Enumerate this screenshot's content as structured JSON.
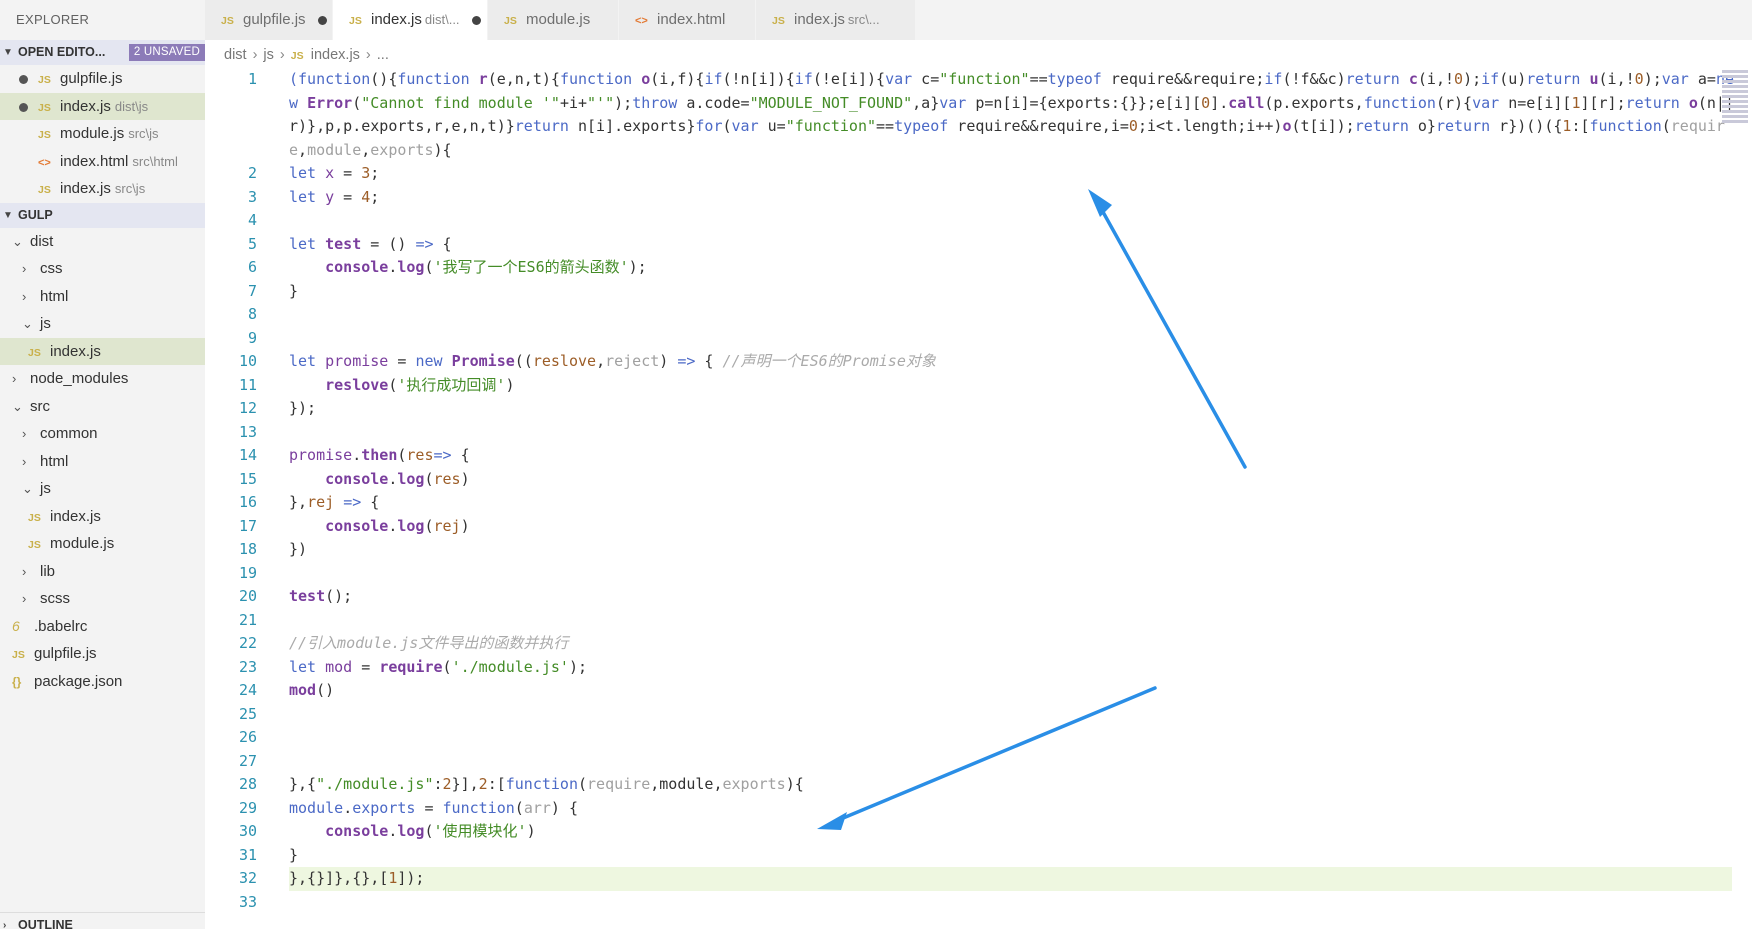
{
  "sidebar": {
    "title": "EXPLORER",
    "open_editors": {
      "label": "OPEN EDITO...",
      "badge": "2 UNSAVED",
      "items": [
        {
          "name": "gulpfile.js",
          "desc": "",
          "icon": "JS",
          "dirty": true,
          "selected": false
        },
        {
          "name": "index.js",
          "desc": "dist\\js",
          "icon": "JS",
          "dirty": true,
          "selected": true
        },
        {
          "name": "module.js",
          "desc": "src\\js",
          "icon": "JS",
          "dirty": false,
          "selected": false
        },
        {
          "name": "index.html",
          "desc": "src\\html",
          "icon": "<>",
          "dirty": false,
          "selected": false
        },
        {
          "name": "index.js",
          "desc": "src\\js",
          "icon": "JS",
          "dirty": false,
          "selected": false
        }
      ]
    },
    "workspace": {
      "label": "GULP",
      "tree": [
        {
          "name": "dist",
          "type": "folder",
          "open": true,
          "depth": 0
        },
        {
          "name": "css",
          "type": "folder",
          "open": false,
          "depth": 1
        },
        {
          "name": "html",
          "type": "folder",
          "open": false,
          "depth": 1
        },
        {
          "name": "js",
          "type": "folder",
          "open": true,
          "depth": 1
        },
        {
          "name": "index.js",
          "type": "js",
          "depth": 2,
          "selected": true
        },
        {
          "name": "node_modules",
          "type": "folder",
          "open": false,
          "depth": 0
        },
        {
          "name": "src",
          "type": "folder",
          "open": true,
          "depth": 0
        },
        {
          "name": "common",
          "type": "folder",
          "open": false,
          "depth": 1
        },
        {
          "name": "html",
          "type": "folder",
          "open": false,
          "depth": 1
        },
        {
          "name": "js",
          "type": "folder",
          "open": true,
          "depth": 1
        },
        {
          "name": "index.js",
          "type": "js",
          "depth": 2
        },
        {
          "name": "module.js",
          "type": "js",
          "depth": 2
        },
        {
          "name": "lib",
          "type": "folder",
          "open": false,
          "depth": 1
        },
        {
          "name": "scss",
          "type": "folder",
          "open": false,
          "depth": 1
        },
        {
          "name": ".babelrc",
          "type": "babel",
          "depth": 0
        },
        {
          "name": "gulpfile.js",
          "type": "js",
          "depth": 0
        },
        {
          "name": "package.json",
          "type": "json",
          "depth": 0
        }
      ]
    },
    "outline_label": "OUTLINE"
  },
  "tabs": [
    {
      "label": "gulpfile.js",
      "desc": "",
      "icon": "JS",
      "dirty": true,
      "active": false
    },
    {
      "label": "index.js",
      "desc": "dist\\...",
      "icon": "JS",
      "dirty": true,
      "active": true
    },
    {
      "label": "module.js",
      "desc": "",
      "icon": "JS",
      "dirty": false,
      "active": false
    },
    {
      "label": "index.html",
      "desc": "",
      "icon": "<>",
      "dirty": false,
      "active": false
    },
    {
      "label": "index.js",
      "desc": "src\\...",
      "icon": "JS",
      "dirty": false,
      "active": false
    }
  ],
  "breadcrumb": {
    "parts": [
      "dist",
      "js",
      "index.js",
      "..."
    ],
    "file_icon": "JS"
  },
  "editor": {
    "line_numbers": [
      "1",
      "2",
      "3",
      "4",
      "5",
      "6",
      "7",
      "8",
      "9",
      "10",
      "11",
      "12",
      "13",
      "14",
      "15",
      "16",
      "17",
      "18",
      "19",
      "20",
      "21",
      "22",
      "23",
      "24",
      "25",
      "26",
      "27",
      "28",
      "29",
      "30",
      "31",
      "32",
      "33"
    ],
    "highlighted_line": "32",
    "code": {
      "l1": "(function(){function r(e,n,t){function o(i,f){if(!n[i]){if(!e[i]){var c=\"function\"==typeof require&&require;if(!f&&c)return c(i,!0);if(u)return u(i,!0);var a=new Error(\"Cannot find module '\"+i+\"'\");throw a.code=\"MODULE_NOT_FOUND\",a}var p=n[i]={exports:{}};e[i][0].call(p.exports,function(r){var n=e[i][1][r];return o(n||r)},p,p.exports,r,e,n,t)}return n[i].exports}for(var u=\"function\"==typeof require&&require,i=0;i<t.length;i++)o(t[i]);return o}return r})()({1:[function(require,module,exports){",
      "l2": "let x = 3;",
      "l3": "let y = 4;",
      "l5": "let test = () => {",
      "l6": "    console.log('我写了一个ES6的箭头函数');",
      "l7": "}",
      "l10": "let promise = new Promise((reslove,reject) => { //声明一个ES6的Promise对象",
      "l11": "    reslove('执行成功回调')",
      "l12": "});",
      "l14": "promise.then(res=> {",
      "l15": "    console.log(res)",
      "l16": "},rej => {",
      "l17": "    console.log(rej)",
      "l18": "})",
      "l20": "test();",
      "l22": "//引入module.js文件导出的函数并执行",
      "l23": "let mod = require('./module.js');",
      "l24": "mod()",
      "l28": "},{\"./module.js\":2}],2:[function(require,module,exports){",
      "l29": "module.exports = function(arr) {",
      "l30": "    console.log('使用模块化')",
      "l31": "}",
      "l32": "},{}]},{},[1]);"
    }
  },
  "annotations": {
    "arrow_color": "#2a8ee6"
  }
}
